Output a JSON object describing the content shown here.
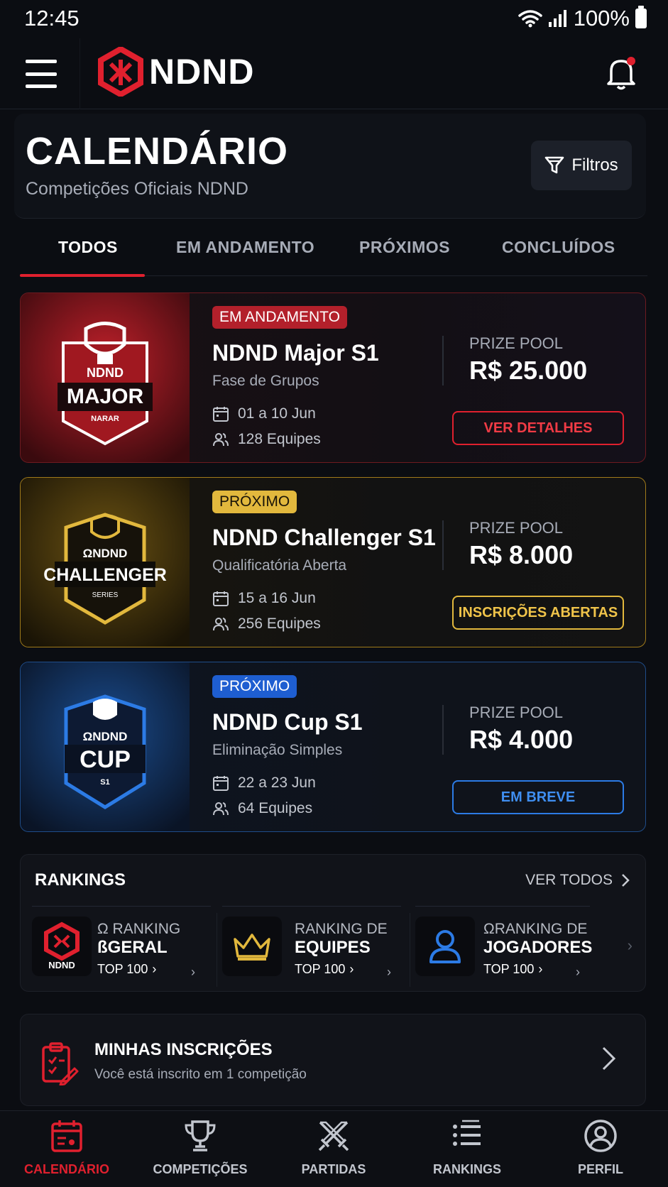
{
  "status_bar": {
    "time": "12:45",
    "battery": "100%"
  },
  "header": {
    "brand": "NDND",
    "colors": {
      "accent": "#e0202e"
    }
  },
  "page": {
    "title": "CALENDÁRIO",
    "subtitle": "Competições Oficiais NDND",
    "filter_label": "Filtros"
  },
  "tabs": [
    {
      "label": "TODOS",
      "active": true
    },
    {
      "label": "EM ANDAMENTO",
      "active": false
    },
    {
      "label": "PRÓXIMOS",
      "active": false
    },
    {
      "label": "CONCLUÍDOS",
      "active": false
    }
  ],
  "competitions": [
    {
      "status": "EM ANDAMENTO",
      "name": "NDND Major S1",
      "stage": "Fase de Grupos",
      "dates": "01 a 10 Jun",
      "teams": "128 Equipes",
      "prize_label": "PRIZE POOL",
      "prize_value": "R$ 25.000",
      "action": "VER DETALHES",
      "art_brand": "NDND",
      "art_title": "MAJOR",
      "art_sub": "NARAR",
      "theme": "#e0202e"
    },
    {
      "status": "PRÓXIMO",
      "name": "NDND Challenger S1",
      "stage": "Qualificatória Aberta",
      "dates": "15 a 16 Jun",
      "teams": "256 Equipes",
      "prize_label": "PRIZE POOL",
      "prize_value": "R$ 8.000",
      "action": "INSCRIÇÕES ABERTAS",
      "art_brand": "ΩNDND",
      "art_title": "CHALLENGER",
      "art_sub": "SERIES",
      "theme": "#e2b83d"
    },
    {
      "status": "PRÓXIMO",
      "name": "NDND Cup S1",
      "stage": "Eliminação Simples",
      "dates": "22 a 23 Jun",
      "teams": "64 Equipes",
      "prize_label": "PRIZE POOL",
      "prize_value": "R$ 4.000",
      "action": "EM BREVE",
      "art_brand": "ΩNDND",
      "art_title": "CUP",
      "art_sub": "S1",
      "theme": "#2c7be5"
    }
  ],
  "rankings": {
    "title": "RANKINGS",
    "view_all": "VER TODOS",
    "items": [
      {
        "line1": "Ω RANKING",
        "line2": "ßGERAL",
        "line3": "TOP 100",
        "icon": "ndnd-logo-icon",
        "icon_label": "NDND"
      },
      {
        "line1": "RANKING DE",
        "line2": "EQUIPES",
        "line3": "TOP 100",
        "icon": "crown-icon"
      },
      {
        "line1": "ΩRANKING DE",
        "line2": "JOGADORES",
        "line3": "TOP 100",
        "icon": "user-icon"
      }
    ]
  },
  "my_registrations": {
    "title": "MINHAS INSCRIÇÕES",
    "subtitle": "Você está inscrito em 1 competição"
  },
  "bottom_nav": [
    {
      "label": "CALENDÁRIO",
      "icon": "calendar-icon",
      "active": true
    },
    {
      "label": "COMPETIÇÕES",
      "icon": "trophy-icon",
      "active": false
    },
    {
      "label": "PARTIDAS",
      "icon": "crossed-swords-icon",
      "active": false
    },
    {
      "label": "RANKINGS",
      "icon": "list-icon",
      "active": false
    },
    {
      "label": "PERFIL",
      "icon": "profile-icon",
      "active": false
    }
  ]
}
